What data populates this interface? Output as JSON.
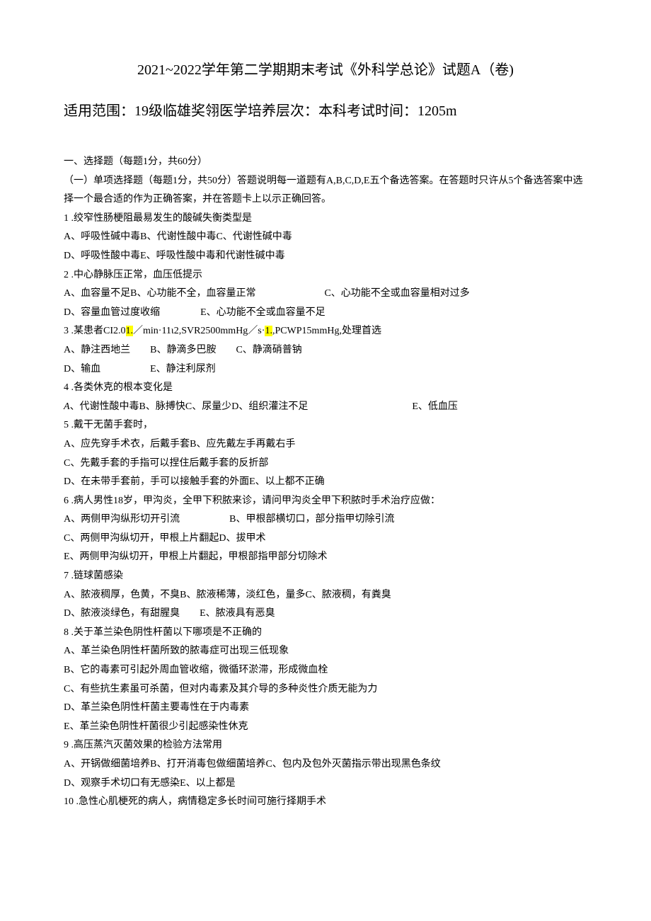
{
  "title": "2021~2022学年第二学期期末考试《外科学总论》试题A（卷)",
  "subtitle": "适用范围：19级临雄奖翎医学培养层次：本科考试时间：1205m",
  "section1_head": "一、选择题（每题1分，共60分）",
  "section1_desc": "（一）单项选择题（每题1分，共50分）答题说明每一道题有A,B,C,D,E五个备选答案。在答题时只许从5个备选答案中选择一个最合适的作为正确答案，并在答题卡上以示正确回答。",
  "q1": {
    "stem": "1 .绞窄性肠梗阻最易发生的酸碱失衡类型是",
    "line1": "A、呼吸性碱中毒B、代谢性酸中毒C、代谢性碱中毒",
    "line2": "D、呼吸性酸中毒E、呼吸性酸中毒和代谢性碱中毒"
  },
  "q2": {
    "stem": "2 .中心静脉压正常，血压低提示",
    "line1a": "A、血容量不足B、心功能不全，血容量正常",
    "line1b": "C、心功能不全或血容量相对过多",
    "line2a": "D、容量血管过度收缩",
    "line2b": "E、心功能不全或血容量不足"
  },
  "q3": {
    "stem_a": "3 .某患者CI2.0",
    "stem_b": "1.",
    "stem_c": "／min·11ι2,SVR2500mmHg／s·",
    "stem_d": "1.",
    "stem_e": ",PCWP15mmHg,处理首选",
    "line1": "A、静注西地兰  B、静滴多巴胺  C、静滴硝普钠",
    "line2": "D、输血     E、静注利尿剂"
  },
  "q4": {
    "stem": "4 .各类休克的根本变化是",
    "line1a": "A",
    "line1b": "、代谢性酸中毒B、脉搏快C、尿量少D、组织灌注不足",
    "line1c": "E、低血压"
  },
  "q5": {
    "stem": "5 .戴干无菌手套时，",
    "line1": "A、应先穿手术衣，后戴手套B、应先戴左手再戴右手",
    "line2": "C、先戴手套的手指可以捏住后戴手套的反折部",
    "line3": "D、在未带手套前，手可以接触手套的外面E、以上都不正确"
  },
  "q6": {
    "stem": "6 .病人男性18岁，甲沟炎，全甲下积脓来诊，请问甲沟炎全甲下积脓时手术治疗应做：",
    "line1": "A、两侧甲沟纵形切开引流     B、甲根部横切口，部分指甲切除引流",
    "line2": "C、两侧甲沟纵切开，甲根上片翻起D、拔甲术",
    "line3": "E、两侧甲沟纵切开，甲根上片翻起，甲根部指甲部分切除术"
  },
  "q7": {
    "stem": "7 .链球菌感染",
    "line1": "A、脓液稠厚，色黄，不臭B、脓液稀薄，淡红色，量多C、脓液稠，有粪臭",
    "line2": "D、脓液淡绿色，有甜腥臭  E、脓液具有恶臭"
  },
  "q8": {
    "stem": "8 .关于革兰染色阴性杆菌以下哪项是不正确的",
    "line1": "A、革兰染色阴性杆菌所致的脓毒症可出现三低现象",
    "line2": "B、它的毒素可引起外周血管收缩，微循环淤滞，形成微血栓",
    "line3": "C、有些抗生素虽可杀菌，但对内毒素及其介导的多种炎性介质无能为力",
    "line4": "D、革兰染色阴性杆菌主要毒性在于内毒素",
    "line5": "E、革兰染色阴性杆菌很少引起感染性休克"
  },
  "q9": {
    "stem": "9 .高压蒸汽灭菌效果的检验方法常用",
    "line1": "A、开锅做细菌培养B、打开消毒包做细菌培养C、包内及包外灭菌指示带出现黑色条纹",
    "line2": "D、观察手术切口有无感染E、以上都是"
  },
  "q10": {
    "stem": "10 .急性心肌梗死的病人，病情稳定多长时间可施行择期手术"
  }
}
